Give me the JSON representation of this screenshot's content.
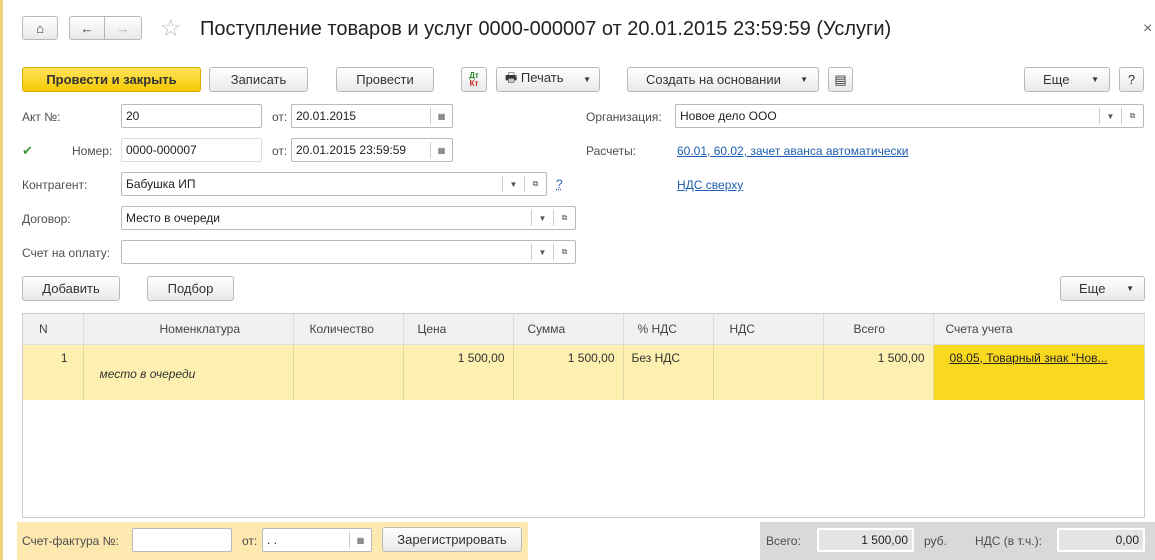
{
  "title": "Поступление товаров и услуг 0000-000007 от 20.01.2015 23:59:59 (Услуги)",
  "toolbar": {
    "post_close": "Провести и закрыть",
    "save": "Записать",
    "post": "Провести",
    "print": "Печать",
    "create_based": "Создать на основании",
    "more": "Еще",
    "help": "?",
    "dtkt_dt": "Дт",
    "dtkt_kt": "Кт"
  },
  "form": {
    "act_label": "Акт №:",
    "act_value": "20",
    "act_date_label": "от:",
    "act_date": "20.01.2015",
    "number_label": "Номер:",
    "number_value": "0000-000007",
    "number_date_label": "от:",
    "number_date": "20.01.2015 23:59:59",
    "counterparty_label": "Контрагент:",
    "counterparty": "Бабушка ИП",
    "counterparty_help": "?",
    "contract_label": "Договор:",
    "contract": "Место в очереди",
    "invoice_label": "Счет на оплату:",
    "invoice": "",
    "org_label": "Организация:",
    "org": "Новое дело ООО",
    "settlements_label": "Расчеты:",
    "settlements_link": "60.01, 60.02, зачет аванса автоматически",
    "vat_link": "НДС сверху"
  },
  "table_toolbar": {
    "add": "Добавить",
    "pick": "Подбор",
    "more": "Еще"
  },
  "table": {
    "columns": [
      "N",
      "Номенклатура",
      "Количество",
      "Цена",
      "Сумма",
      "% НДС",
      "НДС",
      "Всего",
      "Счета учета"
    ],
    "rows": [
      {
        "n": "1",
        "item": "",
        "item_desc": "место в очереди",
        "qty": "",
        "price": "1 500,00",
        "sum": "1 500,00",
        "vat_rate": "Без НДС",
        "vat": "",
        "total": "1 500,00",
        "accounts": "08.05, Товарный знак \"Нов..."
      }
    ]
  },
  "footer": {
    "invoice_label": "Счет-фактура №:",
    "invoice_value": "",
    "date_label": "от:",
    "date_value": " .  .",
    "register": "Зарегистрировать",
    "total_label": "Всего:",
    "total": "1 500,00",
    "currency": "руб.",
    "vat_label": "НДС (в т.ч.):",
    "vat": "0,00"
  },
  "close": "×"
}
